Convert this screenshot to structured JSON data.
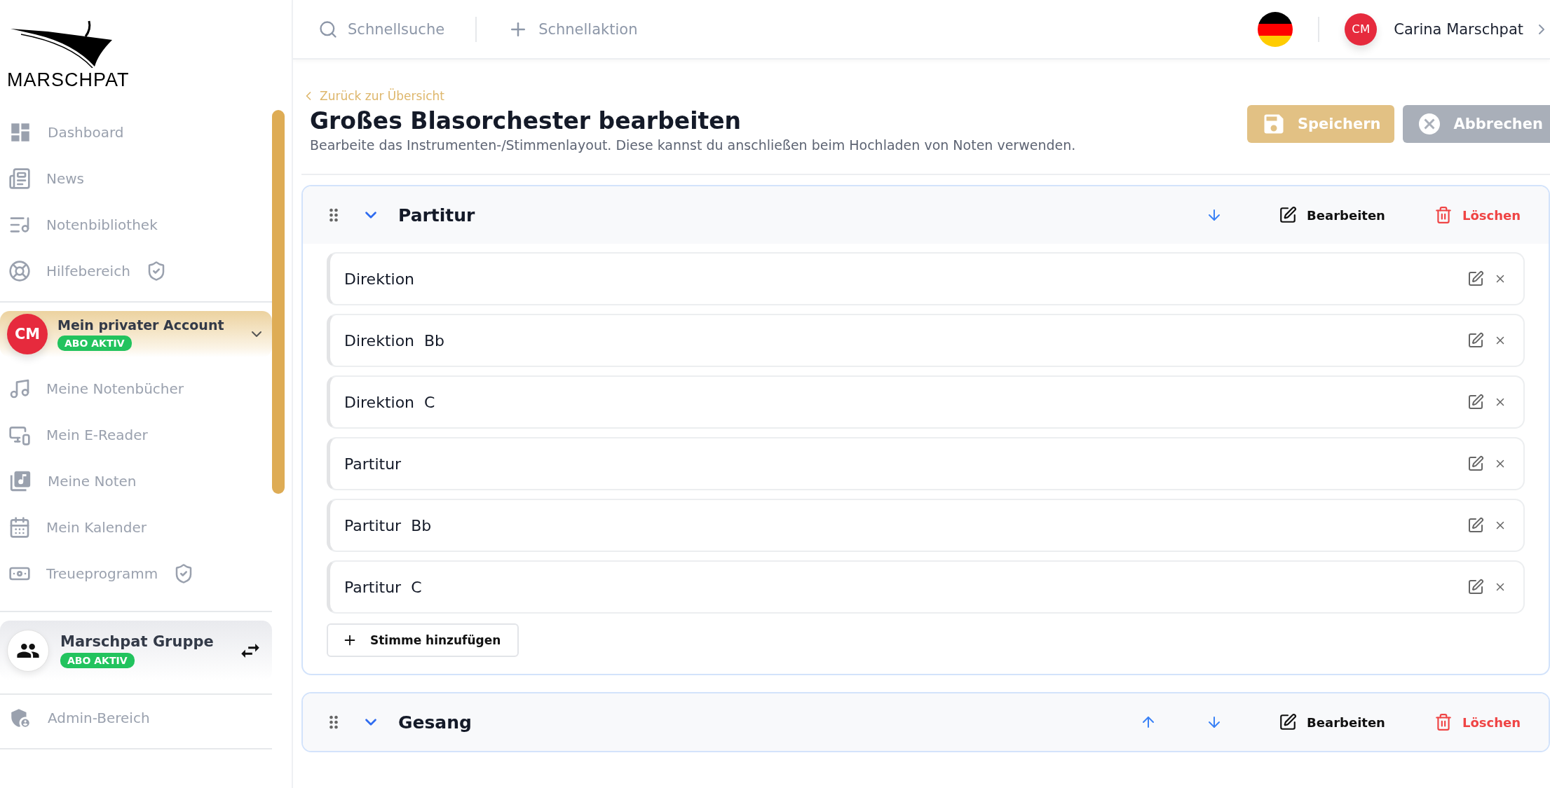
{
  "logo": {
    "text": "MARSCHPAT"
  },
  "nav_main": [
    {
      "label": "Dashboard",
      "restricted": false
    },
    {
      "label": "News",
      "restricted": false
    },
    {
      "label": "Notenbibliothek",
      "restricted": false
    },
    {
      "label": "Hilfebereich",
      "restricted": true
    }
  ],
  "account": {
    "initials": "CM",
    "name": "Mein privater Account",
    "badge": "ABO AKTIV",
    "expanded": false
  },
  "nav_account": [
    {
      "label": "Meine Notenbücher",
      "restricted": false
    },
    {
      "label": "Mein E-Reader",
      "restricted": false
    },
    {
      "label": "Meine Noten",
      "restricted": false
    },
    {
      "label": "Mein Kalender",
      "restricted": false
    },
    {
      "label": "Treueprogramm",
      "restricted": true
    }
  ],
  "group": {
    "name": "Marschpat Gruppe",
    "badge": "ABO AKTIV"
  },
  "nav_admin": [
    {
      "label": "Admin-Bereich",
      "restricted": false
    }
  ],
  "topbar": {
    "search": "Schnellsuche",
    "action": "Schnellaktion",
    "user_initials": "CM",
    "user_name": "Carina Marschpat"
  },
  "page": {
    "back": "Zurück zur Übersicht",
    "title": "Großes Blasorchester bearbeiten",
    "subtitle": "Bearbeite das Instrumenten-/Stimmenlayout. Diese kannst du anschließen beim Hochladen von Noten verwenden.",
    "buttons": [
      {
        "label": "Speichern",
        "kind": "save",
        "disabled": true
      },
      {
        "label": "Abbrechen",
        "kind": "cancel",
        "disabled": true
      }
    ]
  },
  "sections": [
    {
      "title": "Partitur",
      "expanded": true,
      "can_move_up": false,
      "can_move_down": true,
      "edit_label": "Bearbeiten",
      "delete_label": "Löschen",
      "voices": [
        "Direktion",
        "Direktion  Bb",
        "Direktion  C",
        "Partitur",
        "Partitur  Bb",
        "Partitur  C"
      ],
      "add_label": "Stimme hinzufügen"
    },
    {
      "title": "Gesang",
      "expanded": true,
      "can_move_up": true,
      "can_move_down": true,
      "edit_label": "Bearbeiten",
      "delete_label": "Löschen"
    }
  ]
}
